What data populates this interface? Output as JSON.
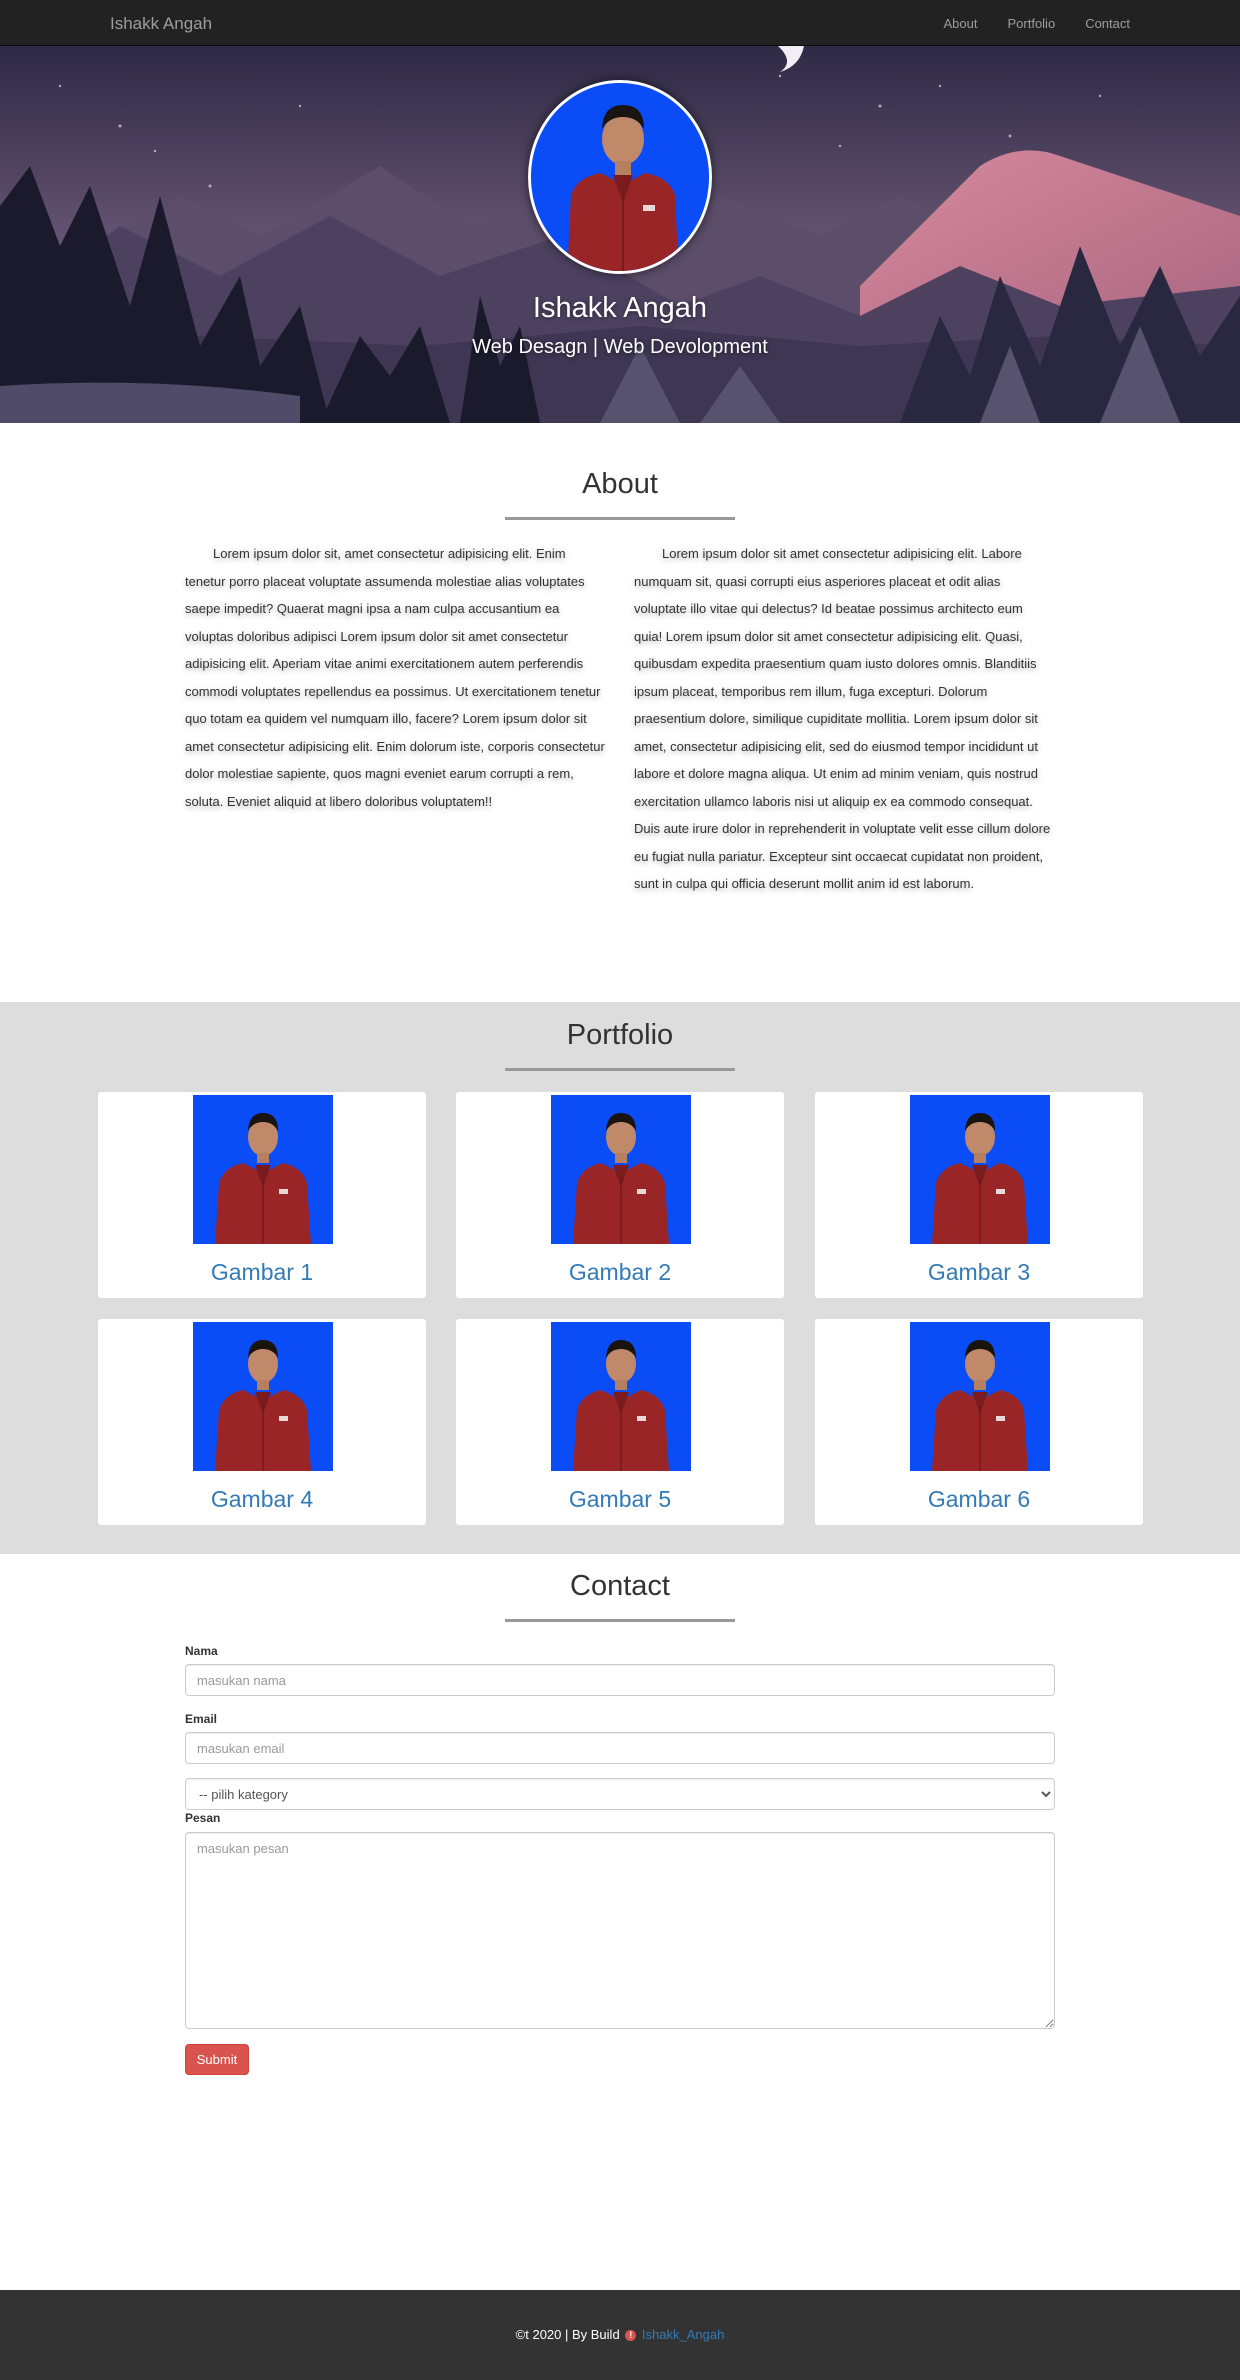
{
  "navbar": {
    "brand": "Ishakk Angah",
    "links": [
      "About",
      "Portfolio",
      "Contact"
    ]
  },
  "hero": {
    "name": "Ishakk Angah",
    "tagline": "Web Desagn | Web Devolopment"
  },
  "about": {
    "title": "About",
    "col_left": "Lorem ipsum dolor sit, amet consectetur adipisicing elit. Enim tenetur porro placeat voluptate assumenda molestiae alias voluptates saepe impedit? Quaerat magni ipsa a nam culpa accusantium ea voluptas doloribus adipisci Lorem ipsum dolor sit amet consectetur adipisicing elit. Aperiam vitae animi exercitationem autem perferendis commodi voluptates repellendus ea possimus. Ut exercitationem tenetur quo totam ea quidem vel numquam illo, facere? Lorem ipsum dolor sit amet consectetur adipisicing elit. Enim dolorum iste, corporis consectetur dolor molestiae sapiente, quos magni eveniet earum corrupti a rem, soluta. Eveniet aliquid at libero doloribus voluptatem!!",
    "col_right": "Lorem ipsum dolor sit amet consectetur adipisicing elit. Labore numquam sit, quasi corrupti eius asperiores placeat et odit alias voluptate illo vitae qui delectus? Id beatae possimus architecto eum quia! Lorem ipsum dolor sit amet consectetur adipisicing elit. Quasi, quibusdam expedita praesentium quam iusto dolores omnis. Blanditiis ipsum placeat, temporibus rem illum, fuga excepturi. Dolorum praesentium dolore, similique cupiditate mollitia. Lorem ipsum dolor sit amet, consectetur adipisicing elit, sed do eiusmod tempor incididunt ut labore et dolore magna aliqua. Ut enim ad minim veniam, quis nostrud exercitation ullamco laboris nisi ut aliquip ex ea commodo consequat. Duis aute irure dolor in reprehenderit in voluptate velit esse cillum dolore eu fugiat nulla pariatur. Excepteur sint occaecat cupidatat non proident, sunt in culpa qui officia deserunt mollit anim id est laborum."
  },
  "portfolio": {
    "title": "Portfolio",
    "items": [
      "Gambar 1",
      "Gambar 2",
      "Gambar 3",
      "Gambar 4",
      "Gambar 5",
      "Gambar 6"
    ]
  },
  "contact": {
    "title": "Contact",
    "name_label": "Nama",
    "name_placeholder": "masukan nama",
    "email_label": "Email",
    "email_placeholder": "masukan email",
    "category_selected": "-- pilih kategory",
    "message_label": "Pesan",
    "message_placeholder": "masukan pesan",
    "submit_label": "Submit"
  },
  "footer": {
    "text": "©t 2020 | By Build",
    "heart": "!",
    "author_link": "Ishakk_Angah"
  },
  "colors": {
    "navbar_bg": "#222222",
    "portfolio_bg": "#dddddd",
    "link_blue": "#337ab7",
    "submit_red": "#d9534f",
    "footer_bg": "#333333",
    "photo_blue": "#0a4cf5"
  }
}
